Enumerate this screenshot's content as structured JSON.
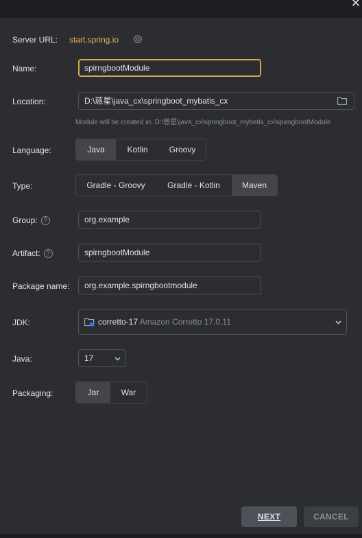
{
  "dialog": {
    "close_glyph": "✕"
  },
  "server": {
    "label": "Server URL:",
    "url": "start.spring.io",
    "icon": "gear-icon"
  },
  "name": {
    "label": "Name:",
    "value": "spirngbootModule"
  },
  "location": {
    "label": "Location:",
    "value": "D:\\慈星\\java_cx\\springboot_mybatis_cx",
    "hint": "Module will be created in: D:\\慈星\\java_cx\\springboot_mybatis_cx\\spirngbootModule",
    "icon": "folder-icon"
  },
  "language": {
    "label": "Language:",
    "options": [
      "Java",
      "Kotlin",
      "Groovy"
    ],
    "selected": "Java"
  },
  "type": {
    "label": "Type:",
    "options": [
      "Gradle - Groovy",
      "Gradle - Kotlin",
      "Maven"
    ],
    "selected": "Maven"
  },
  "group": {
    "label": "Group:",
    "value": "org.example",
    "help": "?"
  },
  "artifact": {
    "label": "Artifact:",
    "value": "spirngbootModule",
    "help": "?"
  },
  "package_name": {
    "label": "Package name:",
    "value": "org.example.spirngbootmodule"
  },
  "jdk": {
    "label": "JDK:",
    "name": "corretto-17",
    "detail": "Amazon Corretto 17.0.11",
    "icon": "jdk-folder-icon"
  },
  "java": {
    "label": "Java:",
    "value": "17"
  },
  "packaging": {
    "label": "Packaging:",
    "options": [
      "Jar",
      "War"
    ],
    "selected": "Jar"
  },
  "buttons": {
    "next": "NEXT",
    "cancel": "CANCEL"
  },
  "colors": {
    "accent": "#e2b75a",
    "focus_border": "#d8a84e",
    "background": "#2b2d30",
    "selected_segment": "#43454a"
  }
}
